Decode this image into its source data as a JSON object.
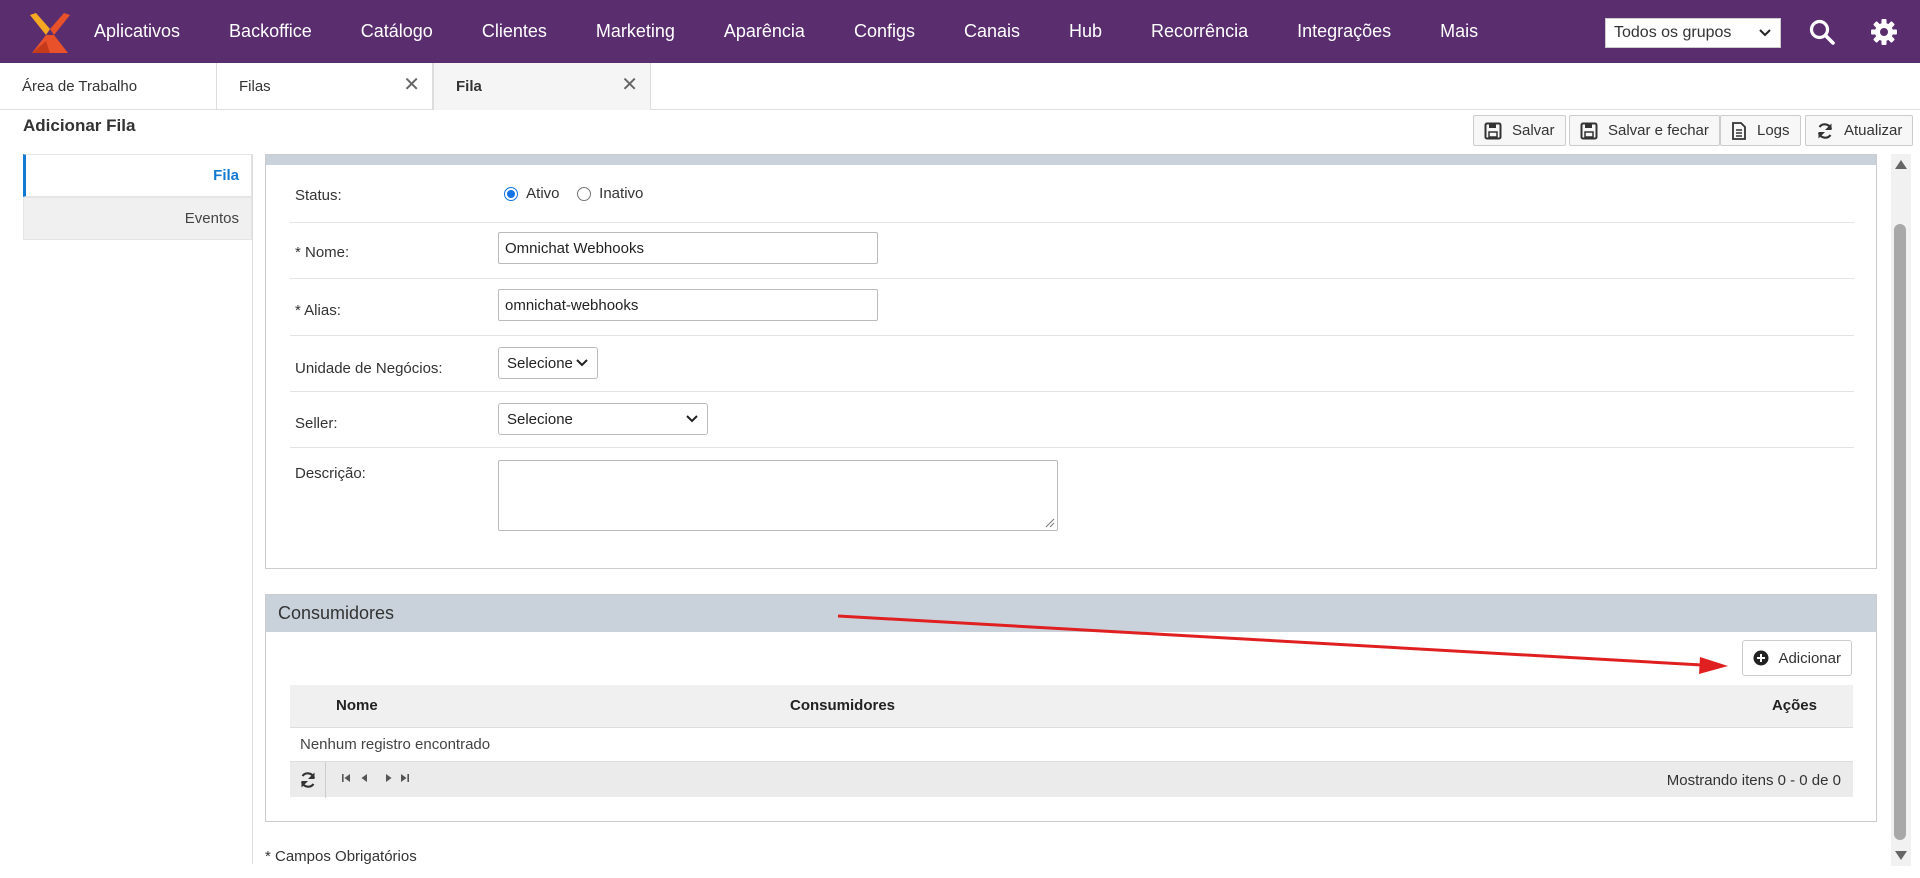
{
  "nav": {
    "items": [
      "Aplicativos",
      "Backoffice",
      "Catálogo",
      "Clientes",
      "Marketing",
      "Aparência",
      "Configs",
      "Canais",
      "Hub",
      "Recorrência",
      "Integrações",
      "Mais"
    ],
    "group_select": "Todos os grupos",
    "brand_colors": {
      "bar": "#5a2d6f",
      "logo_primary": "#e8512a",
      "logo_secondary": "#f7a823"
    }
  },
  "tabs": [
    {
      "label": "Área de Trabalho",
      "closable": false
    },
    {
      "label": "Filas",
      "closable": true
    },
    {
      "label": "Fila",
      "closable": true,
      "active": true
    }
  ],
  "page": {
    "title": "Adicionar Fila"
  },
  "toolbar": {
    "save": "Salvar",
    "save_close": "Salvar e fechar",
    "logs": "Logs",
    "refresh": "Atualizar"
  },
  "side_menu": {
    "items": [
      {
        "label": "Fila",
        "active": true
      },
      {
        "label": "Eventos",
        "active": false
      }
    ]
  },
  "form": {
    "status": {
      "label": "Status:",
      "options": [
        "Ativo",
        "Inativo"
      ],
      "selected": "Ativo"
    },
    "nome": {
      "label": "* Nome:",
      "value": "Omnichat Webhooks"
    },
    "alias": {
      "label": "* Alias:",
      "value": "omnichat-webhooks"
    },
    "unidade": {
      "label": "Unidade de Negócios:",
      "value": "Selecione"
    },
    "seller": {
      "label": "Seller:",
      "value": "Selecione"
    },
    "descricao": {
      "label": "Descrição:",
      "value": ""
    }
  },
  "consumidores": {
    "title": "Consumidores",
    "add_label": "Adicionar",
    "columns": [
      "Nome",
      "Consumidores",
      "Ações"
    ],
    "rows": [],
    "empty_text": "Nenhum registro encontrado",
    "pager_info": "Mostrando itens 0 - 0 de 0"
  },
  "footer_note": "* Campos Obrigatórios",
  "annotation": {
    "color": "#e02020",
    "points_to": "Adicionar"
  }
}
